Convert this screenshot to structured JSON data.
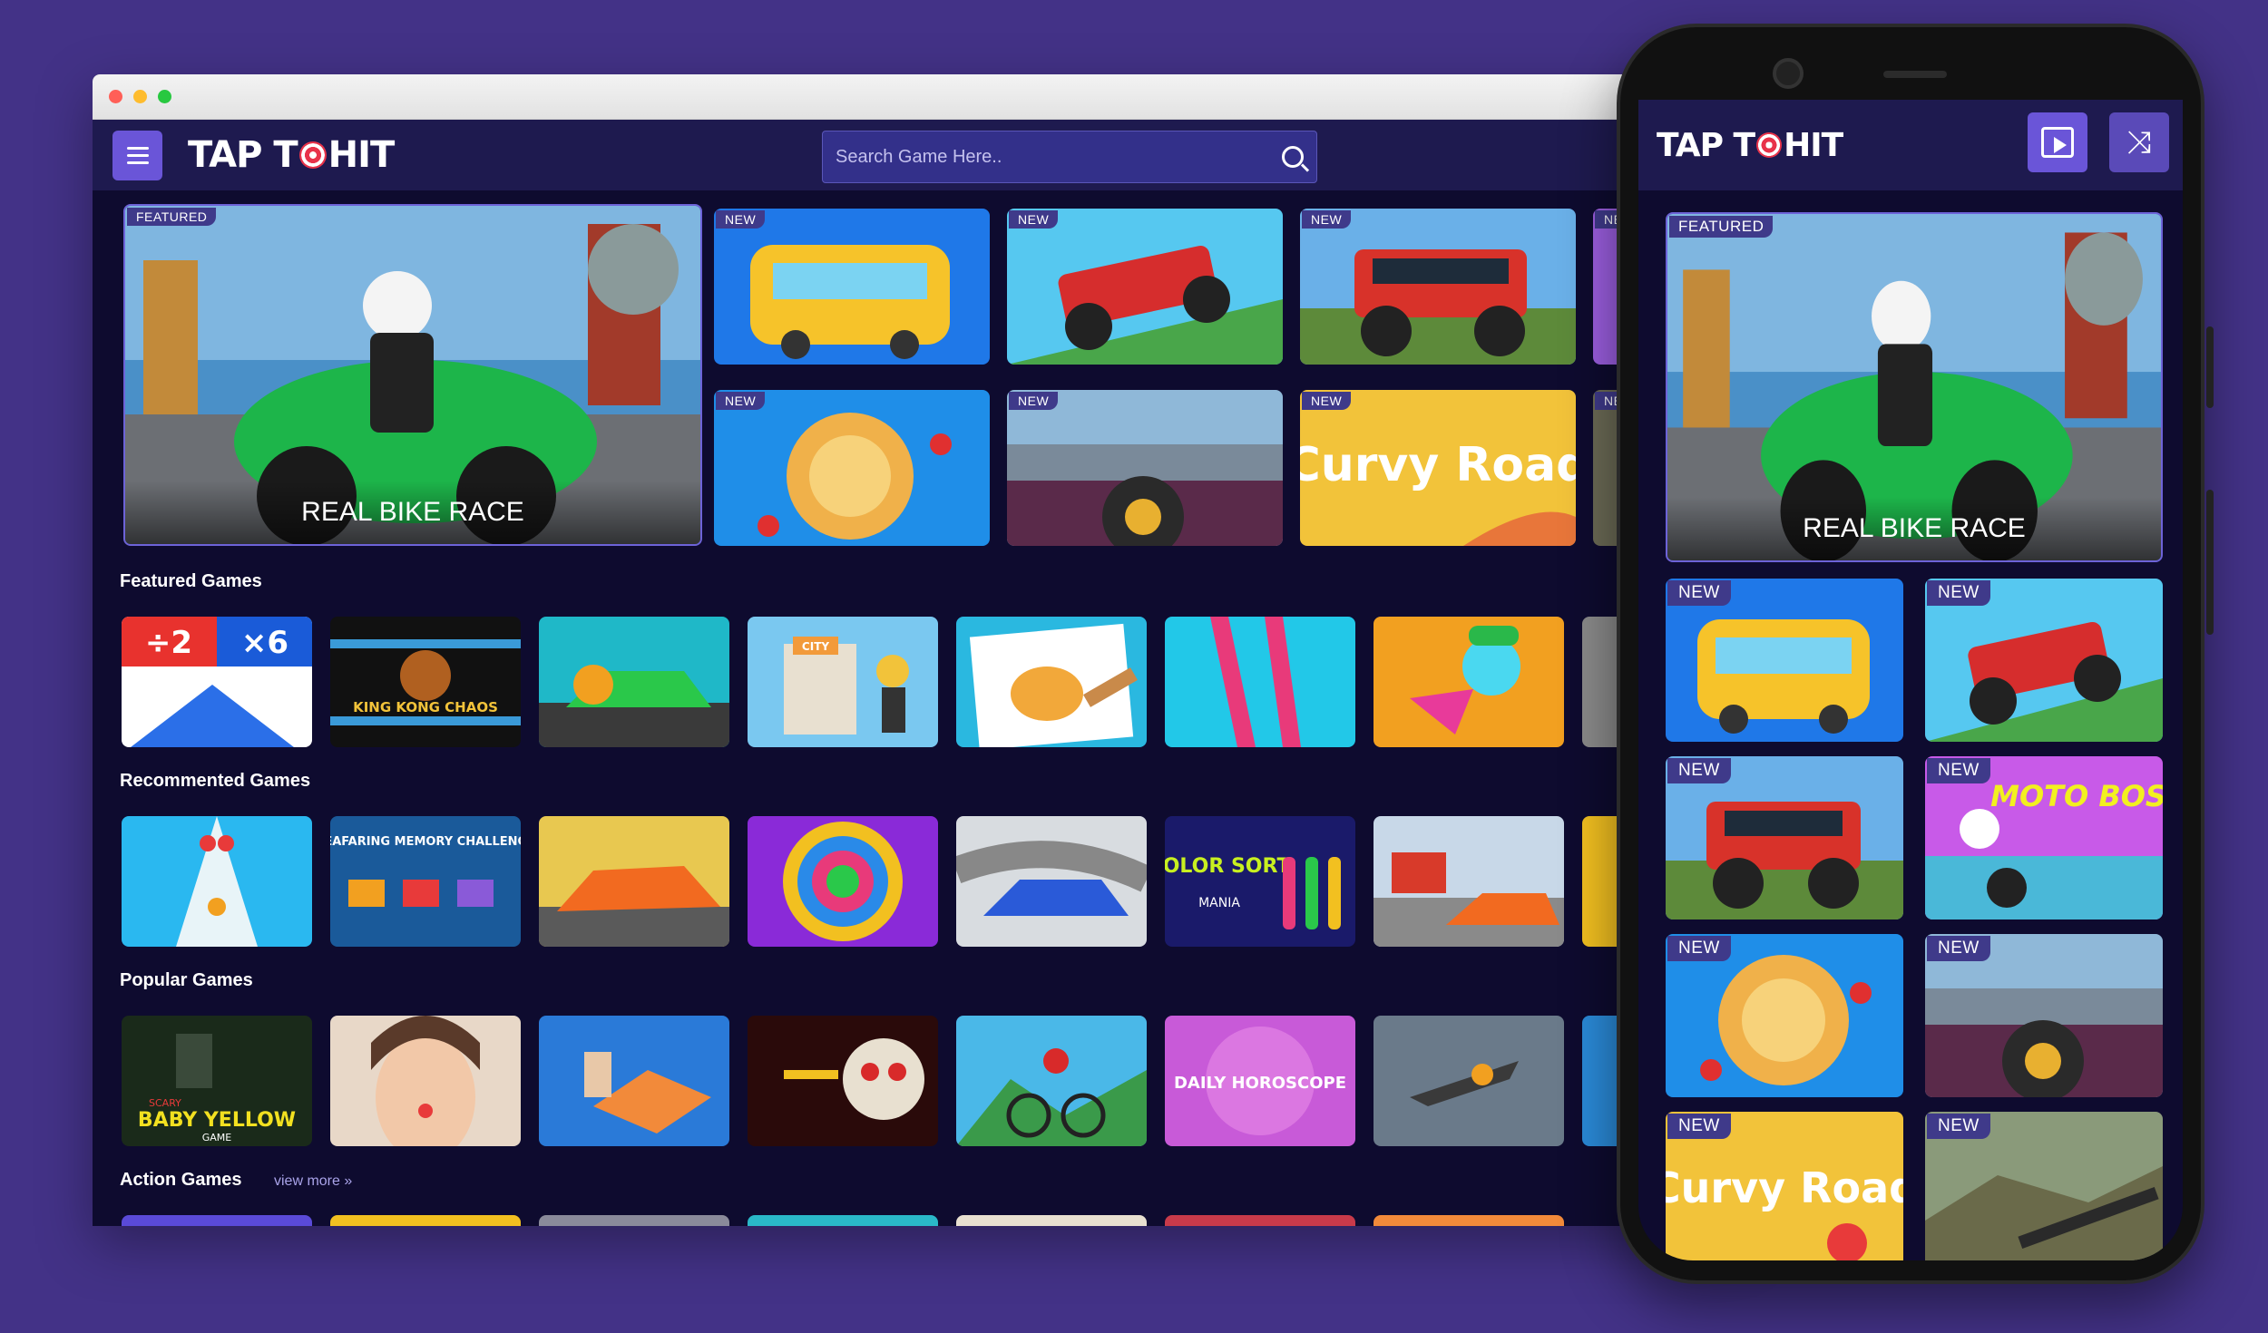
{
  "browser": {
    "dots": [
      "#ff5f57",
      "#febc2e",
      "#28c840"
    ]
  },
  "header": {
    "logo_left": "TAP T",
    "logo_right": "HIT",
    "search_placeholder": "Search Game Here.."
  },
  "hero": {
    "badge": "FEATURED",
    "title": "REAL BIKE RACE",
    "new_badge": "NEW"
  },
  "sections": {
    "featured": "Featured Games",
    "recommended": "Recommented Games",
    "popular": "Popular Games",
    "action": "Action Games",
    "view_more": "view more »"
  },
  "thumb_text": {
    "math_left": "÷2",
    "math_right": "×6",
    "king_kong": "KING KONG CHAOS",
    "city": "CITY",
    "seafaring": "SEAFARING MEMORY CHALLENGE",
    "color_sort": "COLOR SORT",
    "color_sort_sub": "MANIA",
    "baby_yellow": "BABY YELLOW",
    "baby_yellow_top": "SCARY",
    "baby_yellow_sub": "GAME",
    "horoscope": "DAILY HOROSCOPE",
    "curvy": "Curvy Road",
    "moto": "MOTO BOSS"
  },
  "phone": {
    "logo_left": "TAP T",
    "logo_right": "HIT",
    "featured_badge": "FEATURED",
    "featured_title": "REAL BIKE RACE",
    "new_badge": "NEW"
  },
  "colors": {
    "background": "#433287",
    "page": "#0e0b2f",
    "header": "#1e1a4f",
    "accent": "#6a55d8"
  },
  "icons": [
    "menu-icon",
    "search-icon",
    "video-icon",
    "shuffle-icon",
    "target-icon"
  ]
}
